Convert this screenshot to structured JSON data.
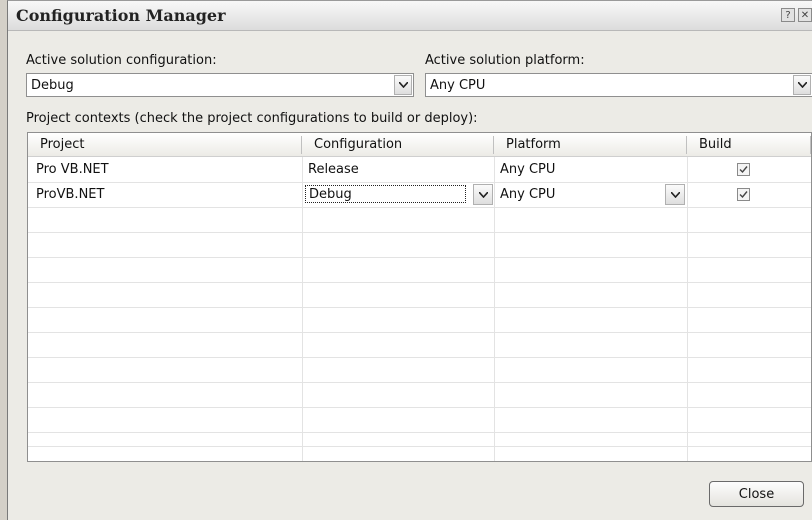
{
  "window": {
    "title": "Configuration Manager",
    "help_glyph": "?",
    "close_glyph": "✕"
  },
  "solution": {
    "config_label": "Active solution configuration:",
    "config_value": "Debug",
    "platform_label": "Active solution platform:",
    "platform_value": "Any CPU"
  },
  "contexts_label": "Project contexts (check the project configurations to build or deploy):",
  "table": {
    "headers": [
      "Project",
      "Configuration",
      "Platform",
      "Build"
    ],
    "rows": [
      {
        "project": "Pro VB.NET",
        "configuration": "Release",
        "platform": "Any CPU",
        "build": true
      },
      {
        "project": "ProVB.NET",
        "configuration": "Debug",
        "platform": "Any CPU",
        "build": true
      }
    ]
  },
  "buttons": {
    "close": "Close"
  }
}
